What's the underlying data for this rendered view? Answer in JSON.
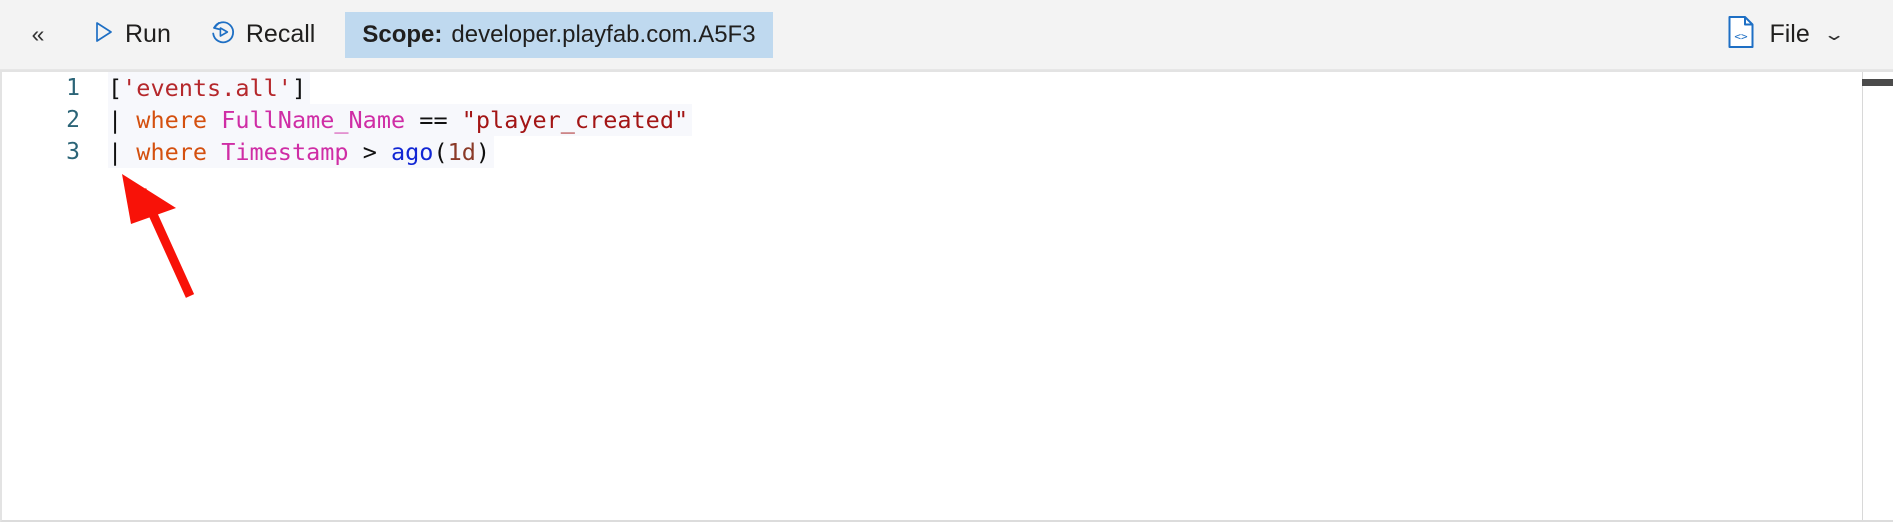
{
  "toolbar": {
    "collapse_icon": "double-chevron-left-icon",
    "run": {
      "label": "Run",
      "icon": "play-triangle-icon"
    },
    "recall": {
      "label": "Recall",
      "icon": "recall-replay-icon"
    },
    "scope": {
      "key_label": "Scope:",
      "value": "developer.playfab.com.A5F3",
      "background_color": "#bfd9ef"
    },
    "file": {
      "label": "File",
      "icon": "code-file-icon",
      "chevron_icon": "chevron-down-icon"
    }
  },
  "editor": {
    "language": "kusto",
    "lines": [
      {
        "number": "1",
        "tokens": [
          {
            "text": "[",
            "cls": "t-punc"
          },
          {
            "text": "'events.all'",
            "cls": "t-str"
          },
          {
            "text": "]",
            "cls": "t-punc"
          }
        ]
      },
      {
        "number": "2",
        "tokens": [
          {
            "text": "| ",
            "cls": "t-pipe"
          },
          {
            "text": "where",
            "cls": "t-kw"
          },
          {
            "text": " ",
            "cls": "t-punc"
          },
          {
            "text": "FullName_Name",
            "cls": "t-col"
          },
          {
            "text": " ",
            "cls": "t-punc"
          },
          {
            "text": "==",
            "cls": "t-op"
          },
          {
            "text": " ",
            "cls": "t-punc"
          },
          {
            "text": "\"player_created\"",
            "cls": "t-strq"
          }
        ]
      },
      {
        "number": "3",
        "tokens": [
          {
            "text": "| ",
            "cls": "t-pipe"
          },
          {
            "text": "where",
            "cls": "t-kw"
          },
          {
            "text": " ",
            "cls": "t-punc"
          },
          {
            "text": "Timestamp",
            "cls": "t-col"
          },
          {
            "text": " ",
            "cls": "t-punc"
          },
          {
            "text": ">",
            "cls": "t-op"
          },
          {
            "text": " ",
            "cls": "t-punc"
          },
          {
            "text": "ago",
            "cls": "t-func"
          },
          {
            "text": "(",
            "cls": "t-punc"
          },
          {
            "text": "1d",
            "cls": "t-lit"
          },
          {
            "text": ")",
            "cls": "t-punc"
          }
        ]
      }
    ],
    "query_text": "['events.all']\n| where FullName_Name == \"player_created\"\n| where Timestamp > ago(1d)",
    "line_number_color": "#2b6477",
    "current_line_highlight": "#f7f8fc"
  },
  "annotation": {
    "arrow_color": "#f81208",
    "points_to": "line-3-start"
  }
}
